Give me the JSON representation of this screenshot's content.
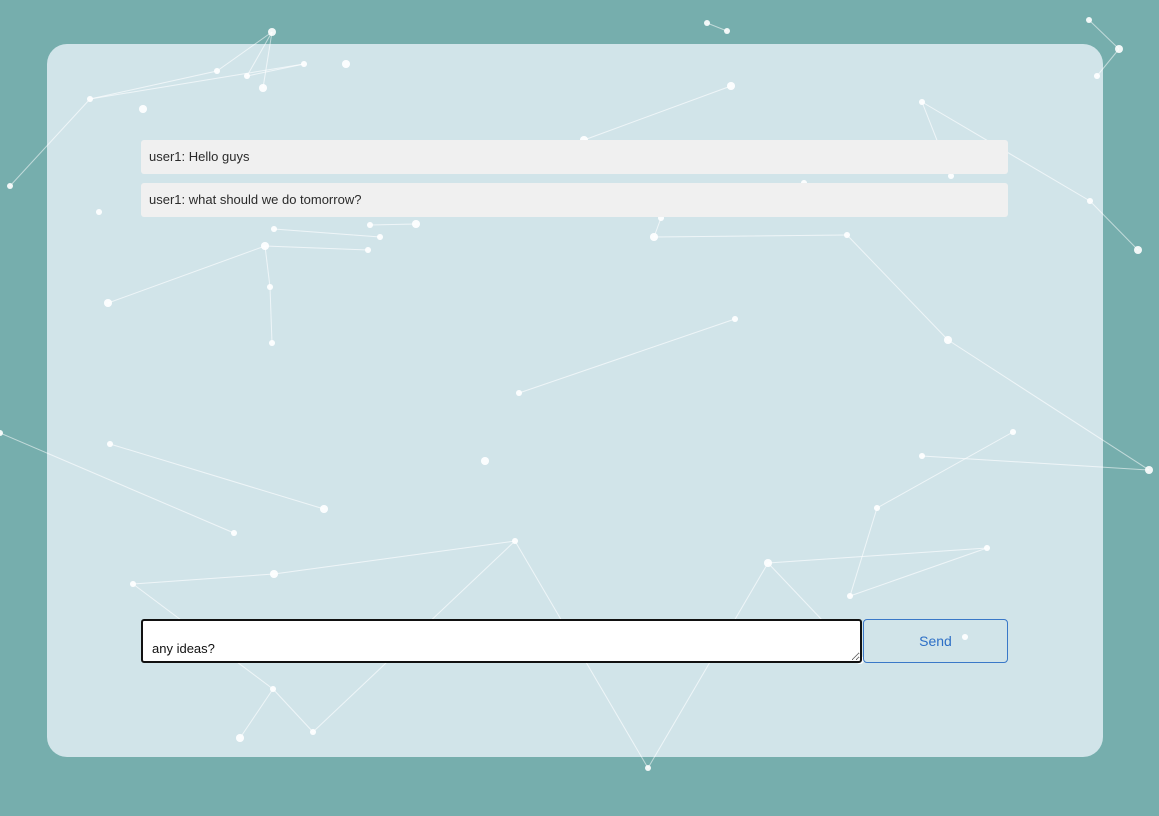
{
  "colors": {
    "page_background": "#76aead",
    "panel_background": "#e2eef4",
    "message_background": "#f0f0f0",
    "send_button_accent": "#2d6fc6"
  },
  "messages": [
    {
      "text": "user1: Hello guys"
    },
    {
      "text": "user1: what should we do tomorrow?"
    }
  ],
  "composer": {
    "input_value": "any ideas?",
    "send_label": "Send"
  }
}
